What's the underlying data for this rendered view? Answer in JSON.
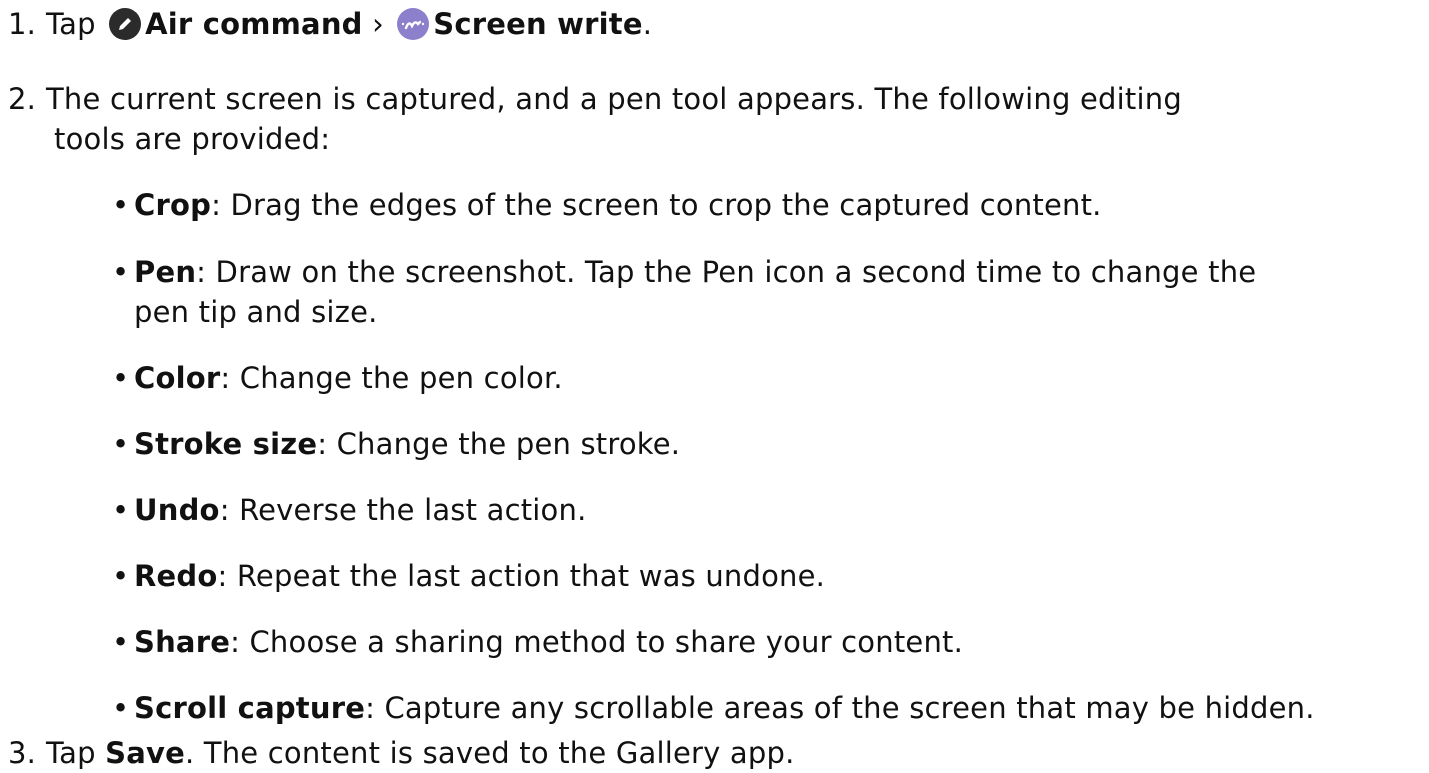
{
  "steps": [
    {
      "number": "1.",
      "prefix": "Tap",
      "air_command": "Air command",
      "separator": "›",
      "screen_write": "Screen write",
      "suffix": ".",
      "icons": [
        "pen-icon",
        "screen-write-icon"
      ]
    },
    {
      "number": "2.",
      "text_line1": "The current screen is captured, and a pen tool appears. The following editing",
      "text_line2": "tools are provided:",
      "tools": [
        {
          "name": "Crop",
          "desc": ": Drag the edges of the screen to crop the captured content."
        },
        {
          "name": "Pen",
          "desc": ": Draw on the screenshot. Tap the Pen icon a second time to change the",
          "desc_line2": "pen tip and size."
        },
        {
          "name": "Color",
          "desc": ": Change the pen color."
        },
        {
          "name": "Stroke size",
          "desc": ": Change the pen stroke."
        },
        {
          "name": "Undo",
          "desc": ": Reverse the last action."
        },
        {
          "name": "Redo",
          "desc": ": Repeat the last action that was undone."
        },
        {
          "name": "Share",
          "desc": ": Choose a sharing method to share your content."
        },
        {
          "name": "Scroll capture",
          "desc": ": Capture any scrollable areas of the screen that may be hidden."
        }
      ]
    },
    {
      "number": "3.",
      "prefix": "Tap ",
      "save": "Save",
      "suffix": ". The content is saved to the Gallery app."
    }
  ],
  "bullet_char": "•",
  "colors": {
    "text": "#111111",
    "pen_icon_bg": "#2b2b2b",
    "screen_write_icon_bg": "#8c80cc"
  }
}
